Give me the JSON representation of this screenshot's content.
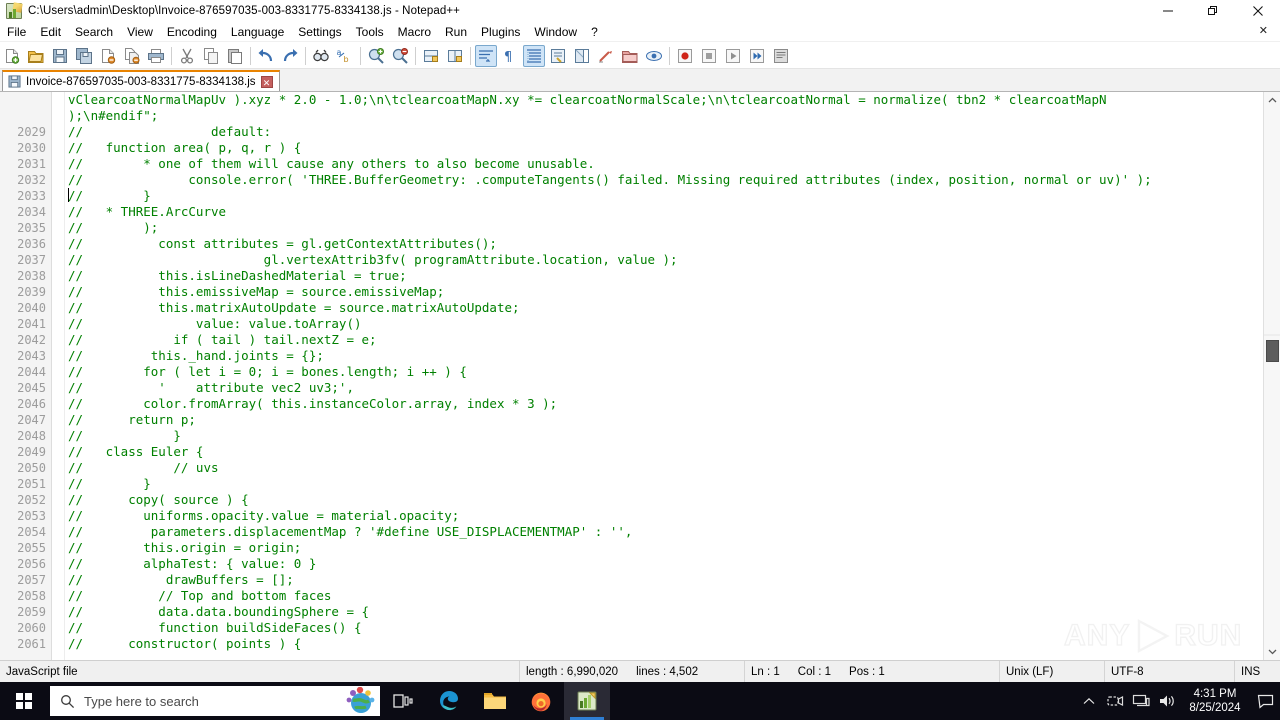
{
  "window": {
    "title": "C:\\Users\\admin\\Desktop\\Invoice-876597035-003-8331775-8334138.js - Notepad++",
    "icon": "notepad-plus-plus-icon",
    "minimize": "—",
    "restore": "❐",
    "close": "✕",
    "menu_close_document": "✕"
  },
  "menu": {
    "items": [
      {
        "label": "File"
      },
      {
        "label": "Edit"
      },
      {
        "label": "Search"
      },
      {
        "label": "View"
      },
      {
        "label": "Encoding"
      },
      {
        "label": "Language"
      },
      {
        "label": "Settings"
      },
      {
        "label": "Tools"
      },
      {
        "label": "Macro"
      },
      {
        "label": "Run"
      },
      {
        "label": "Plugins"
      },
      {
        "label": "Window"
      },
      {
        "label": "?"
      }
    ]
  },
  "toolbar": {
    "buttons": [
      {
        "name": "new-file-icon",
        "pressed": false
      },
      {
        "name": "open-file-icon",
        "pressed": false
      },
      {
        "name": "save-icon",
        "pressed": false
      },
      {
        "name": "save-all-icon",
        "pressed": false
      },
      {
        "name": "close-file-icon",
        "pressed": false
      },
      {
        "name": "close-all-files-icon",
        "pressed": false
      },
      {
        "name": "print-icon",
        "pressed": false
      },
      {
        "name": "separator"
      },
      {
        "name": "cut-icon",
        "pressed": false
      },
      {
        "name": "copy-icon",
        "pressed": false
      },
      {
        "name": "paste-icon",
        "pressed": false
      },
      {
        "name": "separator"
      },
      {
        "name": "undo-icon",
        "pressed": false
      },
      {
        "name": "redo-icon",
        "pressed": false
      },
      {
        "name": "separator"
      },
      {
        "name": "find-icon",
        "pressed": false
      },
      {
        "name": "replace-icon",
        "pressed": false
      },
      {
        "name": "separator"
      },
      {
        "name": "zoom-in-icon",
        "pressed": false
      },
      {
        "name": "zoom-out-icon",
        "pressed": false
      },
      {
        "name": "separator"
      },
      {
        "name": "sync-vertical-scroll-icon",
        "pressed": false
      },
      {
        "name": "sync-horizontal-scroll-icon",
        "pressed": false
      },
      {
        "name": "separator"
      },
      {
        "name": "word-wrap-icon",
        "pressed": true
      },
      {
        "name": "show-all-characters-icon",
        "pressed": false
      },
      {
        "name": "indent-guide-icon",
        "pressed": true
      },
      {
        "name": "user-defined-dialog-icon",
        "pressed": false
      },
      {
        "name": "show-document-map-icon",
        "pressed": false
      },
      {
        "name": "function-list-icon",
        "pressed": false
      },
      {
        "name": "folder-as-workspace-icon",
        "pressed": false
      },
      {
        "name": "monitoring-icon",
        "pressed": false
      },
      {
        "name": "separator"
      },
      {
        "name": "record-macro-icon",
        "pressed": false
      },
      {
        "name": "stop-macro-icon",
        "pressed": false
      },
      {
        "name": "play-macro-icon",
        "pressed": false
      },
      {
        "name": "run-macro-multiple-icon",
        "pressed": false
      },
      {
        "name": "save-macro-icon",
        "pressed": false
      }
    ]
  },
  "tabs": [
    {
      "label": "Invoice-876597035-003-8331775-8334138.js",
      "icon": "save-icon",
      "close": "✕",
      "active": true
    }
  ],
  "editor": {
    "language": "JavaScript",
    "wrapped_continuation_lines": [
      "vClearcoatNormalMapUv ).xyz * 2.0 - 1.0;\\n\\tclearcoatMapN.xy *= clearcoatNormalScale;\\n\\tclearcoatNormal = normalize( tbn2 * clearcoatMapN",
      ");\\n#endif\";"
    ],
    "lines": [
      {
        "number": "2029",
        "text": "//                 default:"
      },
      {
        "number": "2030",
        "text": "//   function area( p, q, r ) {"
      },
      {
        "number": "2031",
        "text": "//        * one of them will cause any others to also become unusable."
      },
      {
        "number": "2032",
        "text": "//              console.error( 'THREE.BufferGeometry: .computeTangents() failed. Missing required attributes (index, position, normal or uv)' );"
      },
      {
        "number": "2033",
        "text": "//        }"
      },
      {
        "number": "2034",
        "text": "//   * THREE.ArcCurve"
      },
      {
        "number": "2035",
        "text": "//        );"
      },
      {
        "number": "2036",
        "text": "//          const attributes = gl.getContextAttributes();"
      },
      {
        "number": "2037",
        "text": "//                        gl.vertexAttrib3fv( programAttribute.location, value );"
      },
      {
        "number": "2038",
        "text": "//          this.isLineDashedMaterial = true;"
      },
      {
        "number": "2039",
        "text": "//          this.emissiveMap = source.emissiveMap;"
      },
      {
        "number": "2040",
        "text": "//          this.matrixAutoUpdate = source.matrixAutoUpdate;"
      },
      {
        "number": "2041",
        "text": "//               value: value.toArray()"
      },
      {
        "number": "2042",
        "text": "//            if ( tail ) tail.nextZ = e;"
      },
      {
        "number": "2043",
        "text": "//         this._hand.joints = {};"
      },
      {
        "number": "2044",
        "text": "//        for ( let i = 0; i = bones.length; i ++ ) {"
      },
      {
        "number": "2045",
        "text": "//          '    attribute vec2 uv3;',"
      },
      {
        "number": "2046",
        "text": "//        color.fromArray( this.instanceColor.array, index * 3 );"
      },
      {
        "number": "2047",
        "text": "//      return p;"
      },
      {
        "number": "2048",
        "text": "//            }"
      },
      {
        "number": "2049",
        "text": "//   class Euler {"
      },
      {
        "number": "2050",
        "text": "//            // uvs"
      },
      {
        "number": "2051",
        "text": "//        }"
      },
      {
        "number": "2052",
        "text": "//      copy( source ) {"
      },
      {
        "number": "2053",
        "text": "//        uniforms.opacity.value = material.opacity;"
      },
      {
        "number": "2054",
        "text": "//         parameters.displacementMap ? '#define USE_DISPLACEMENTMAP' : '',"
      },
      {
        "number": "2055",
        "text": "//        this.origin = origin;"
      },
      {
        "number": "2056",
        "text": "//        alphaTest: { value: 0 }"
      },
      {
        "number": "2057",
        "text": "//           drawBuffers = [];"
      },
      {
        "number": "2058",
        "text": "//          // Top and bottom faces"
      },
      {
        "number": "2059",
        "text": "//          data.data.boundingSphere = {"
      },
      {
        "number": "2060",
        "text": "//          function buildSideFaces() {"
      },
      {
        "number": "2061",
        "text": "//      constructor( points ) {"
      }
    ],
    "code_color": "#008000",
    "scrollbar": {
      "up_arrow": "⌃",
      "down_arrow": "⌄"
    }
  },
  "watermark": {
    "left_text": "ANY",
    "right_text": "RUN",
    "icon": "play-triangle-icon"
  },
  "statusbar": {
    "file_type": "JavaScript file",
    "length_label": "length : 6,990,020",
    "lines_label": "lines : 4,502",
    "ln": "Ln : 1",
    "col": "Col : 1",
    "pos": "Pos : 1",
    "eol": "Unix (LF)",
    "encoding": "UTF-8",
    "insert_mode": "INS"
  },
  "taskbar": {
    "start": "windows-logo-icon",
    "search": {
      "placeholder": "Type here to search",
      "icon": "search-icon",
      "decor_icon": "earth-globe-icon"
    },
    "items": [
      {
        "name": "task-view-icon",
        "active": false
      },
      {
        "name": "microsoft-edge-icon",
        "active": false
      },
      {
        "name": "file-explorer-icon",
        "active": false
      },
      {
        "name": "firefox-icon",
        "active": false
      },
      {
        "name": "notepad-plus-plus-icon",
        "active": true
      }
    ],
    "tray": {
      "chevron": "⌃",
      "icons": [
        "screen-recorder-icon",
        "network-icon",
        "volume-icon"
      ],
      "time": "4:31 PM",
      "date": "8/25/2024",
      "notification": "notification-icon"
    }
  }
}
